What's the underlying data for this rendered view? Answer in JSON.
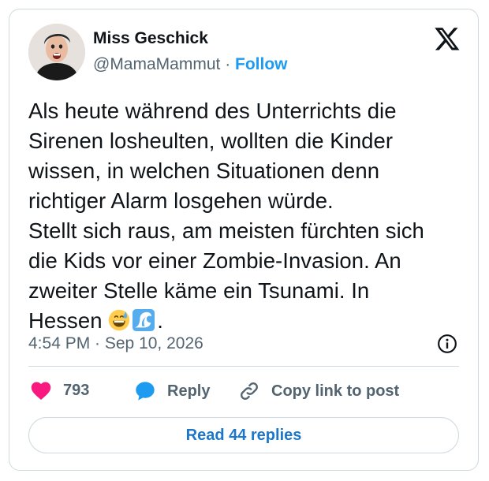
{
  "tweet": {
    "author": {
      "name": "Miss Geschick",
      "handle": "@MamaMammut",
      "separator": "·",
      "follow_label": "Follow"
    },
    "platform_logo": "x-logo-icon",
    "text_lines": [
      "Als heute während des Unterrichts die",
      "Sirenen losheulten, wollten die Kinder",
      "wissen, in welchen Situationen denn",
      "richtiger Alarm losgehen würde.",
      "Stellt sich raus, am meisten fürchten sich",
      "die Kids vor einer Zombie-Invasion. An",
      "zweiter Stelle käme ein Tsunami. In",
      "Hessen"
    ],
    "text_end": ".",
    "emojis": [
      "grinning-sweat-emoji",
      "water-wave-emoji"
    ],
    "timestamp": "4:54 PM · Sep 10, 2026",
    "info_icon": "info-icon"
  },
  "actions": {
    "likes_count": "793",
    "like_icon": "heart-icon",
    "reply_label": "Reply",
    "reply_icon": "speech-bubble-icon",
    "copy_label": "Copy link to post",
    "copy_icon": "link-icon"
  },
  "footer": {
    "read_replies_label": "Read 44 replies"
  },
  "colors": {
    "accent": "#1d9bf0",
    "like": "#f91880",
    "text": "#0f1419",
    "muted": "#536471",
    "border": "#cfd9de"
  }
}
